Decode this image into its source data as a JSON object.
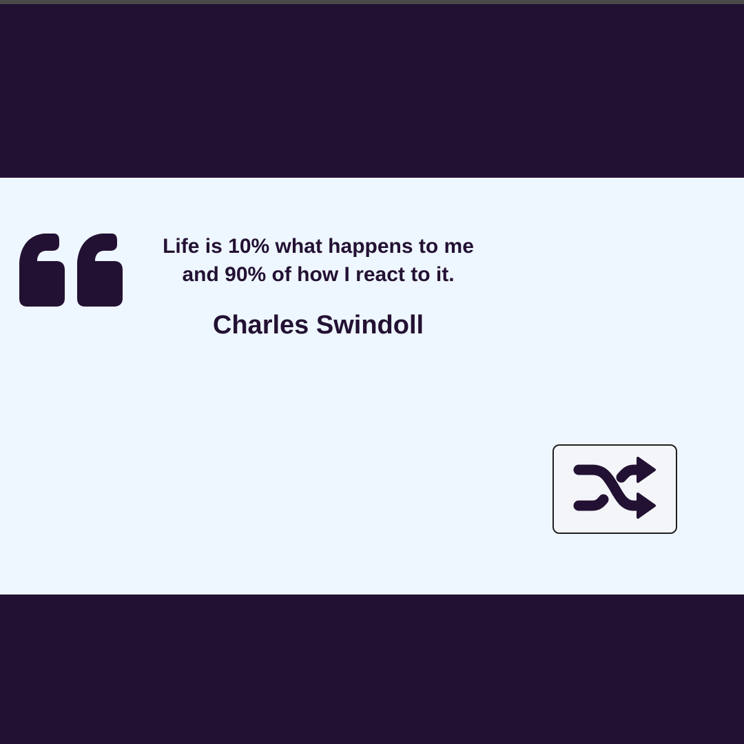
{
  "quote": {
    "text_line1": "Life is 10% what happens to me",
    "text_line2": "and 90% of how I react to it.",
    "author": "Charles Swindoll"
  },
  "icons": {
    "quote_mark": "quote-left-icon",
    "shuffle": "shuffle-icon"
  },
  "colors": {
    "background": "#231133",
    "card": "#eef6ff",
    "text": "#231133",
    "button_background": "#f4f5f9"
  }
}
